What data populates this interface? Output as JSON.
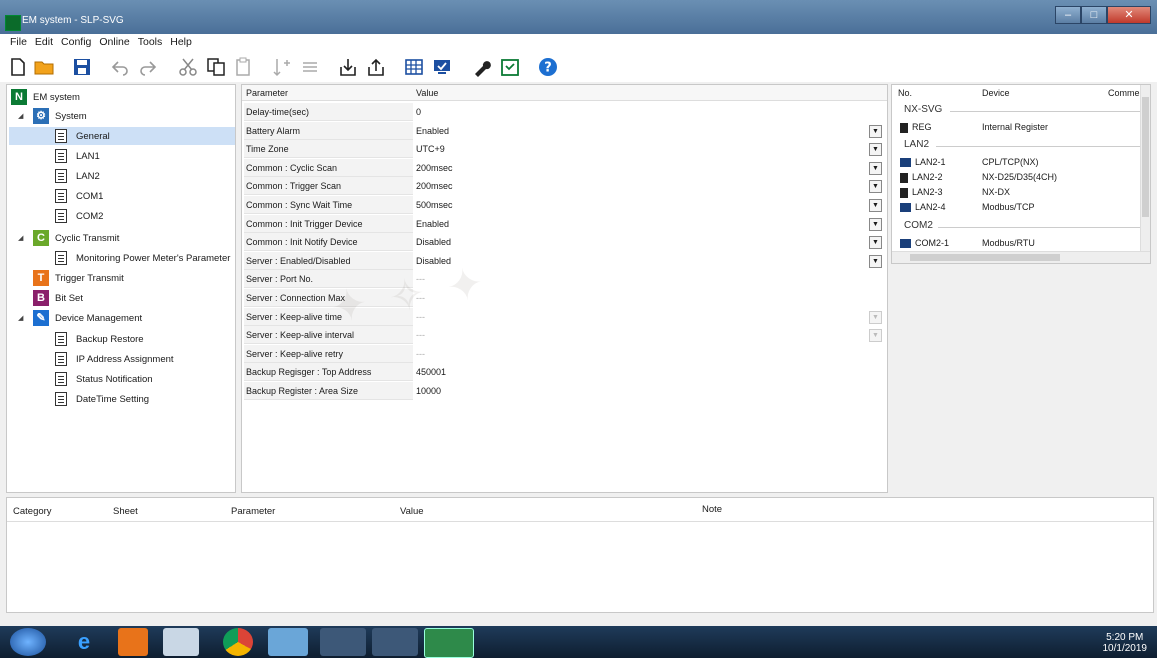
{
  "window": {
    "title": "EM system - SLP-SVG"
  },
  "menu": [
    "File",
    "Edit",
    "Config",
    "Online",
    "Tools",
    "Help"
  ],
  "tree": {
    "root": "EM system",
    "system": "System",
    "system_children": [
      "General",
      "LAN1",
      "LAN2",
      "COM1",
      "COM2"
    ],
    "cyclic": "Cyclic Transmit",
    "cyclic_children": [
      "Monitoring Power Meter's Parameter"
    ],
    "trigger": "Trigger Transmit",
    "bitset": "Bit Set",
    "device_mgmt": "Device Management",
    "device_children": [
      "Backup Restore",
      "IP Address Assignment",
      "Status Notification",
      "DateTime Setting"
    ]
  },
  "params": {
    "header_param": "Parameter",
    "header_value": "Value",
    "rows": [
      {
        "name": "Delay-time(sec)",
        "value": "0"
      },
      {
        "name": "Battery Alarm",
        "value": "Enabled"
      },
      {
        "name": "Time Zone",
        "value": "UTC+9"
      },
      {
        "name": "Common : Cyclic Scan",
        "value": "200msec"
      },
      {
        "name": "Common : Trigger Scan",
        "value": "200msec"
      },
      {
        "name": "Common : Sync Wait Time",
        "value": "500msec"
      },
      {
        "name": "Common : Init Trigger Device",
        "value": "Enabled"
      },
      {
        "name": "Common : Init Notify Device",
        "value": "Disabled"
      },
      {
        "name": "Server : Enabled/Disabled",
        "value": "Disabled"
      },
      {
        "name": "Server : Port No.",
        "value": "---"
      },
      {
        "name": "Server : Connection Max",
        "value": "---"
      },
      {
        "name": "Server : Keep-alive time",
        "value": "---"
      },
      {
        "name": "Server : Keep-alive interval",
        "value": "---"
      },
      {
        "name": "Server : Keep-alive retry",
        "value": "---"
      },
      {
        "name": "Backup Regisger : Top Address",
        "value": "450001"
      },
      {
        "name": "Backup Register : Area Size",
        "value": "10000"
      }
    ]
  },
  "devices": {
    "header_no": "No.",
    "header_device": "Device",
    "header_comment": "Comme",
    "group_nxsvg": "NX-SVG",
    "group_lan2": "LAN2",
    "group_com2": "COM2",
    "rows": [
      {
        "no": "REG",
        "device": "Internal Register"
      },
      {
        "no": "LAN2-1",
        "device": "CPL/TCP(NX)"
      },
      {
        "no": "LAN2-2",
        "device": "NX-D25/D35(4CH)"
      },
      {
        "no": "LAN2-3",
        "device": "NX-DX"
      },
      {
        "no": "LAN2-4",
        "device": "Modbus/TCP"
      },
      {
        "no": "COM2-1",
        "device": "Modbus/RTU"
      }
    ]
  },
  "bottom": {
    "cols": [
      "Category",
      "Sheet",
      "Parameter",
      "Value",
      "Note"
    ]
  },
  "taskbar": {
    "time": "5:20 PM",
    "date": "10/1/2019"
  },
  "colors": {
    "accent_green": "#0b7a34",
    "titlebar": "#4a6f98",
    "selection": "#cde0f6"
  }
}
